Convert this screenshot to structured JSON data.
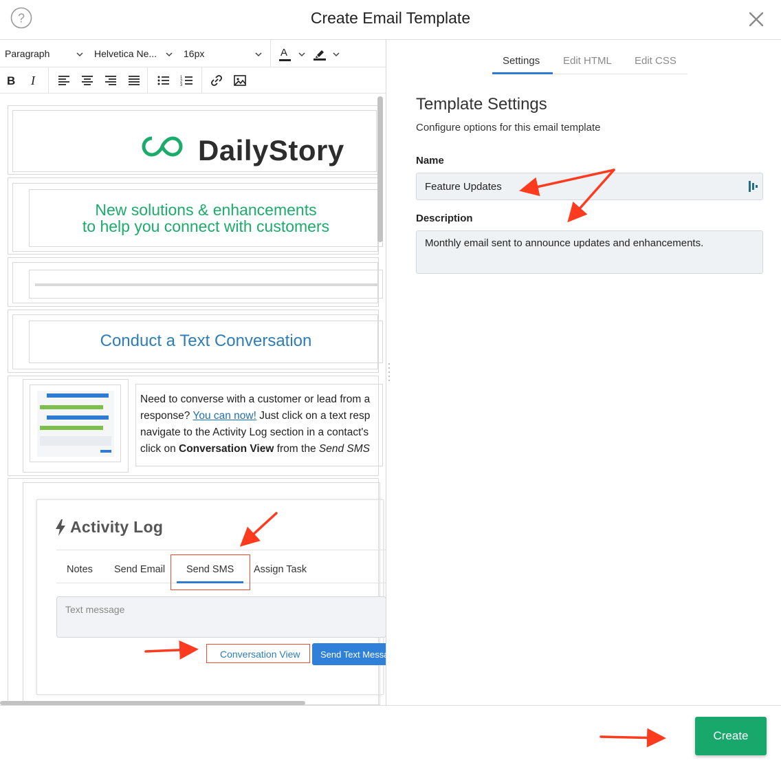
{
  "header": {
    "title": "Create Email Template"
  },
  "toolbar": {
    "block_format": "Paragraph",
    "font_family": "Helvetica Ne...",
    "font_size": "16px",
    "text_color_glyph": "A"
  },
  "email": {
    "logo_text": "DailyStory",
    "hero_line1": "New solutions & enhancements",
    "hero_line2": "to help you connect with customers",
    "heading": "Conduct a Text Conversation",
    "body_line1": "Need to converse with a customer or lead from a",
    "body_line2_pre": "response? ",
    "body_link": "You can now!",
    "body_line2_post": " Just click on a text resp",
    "body_line3": "navigate to the Activity Log section in a contact's",
    "body_line4_pre": "click on ",
    "body_line4_bold": "Conversation View",
    "body_line4_mid": " from the ",
    "body_line4_italic": "Send SMS",
    "activity": {
      "title": "Activity Log",
      "tabs": [
        "Notes",
        "Send Email",
        "Send SMS",
        "Assign Task"
      ],
      "input_placeholder": "Text message",
      "conversation_view": "Conversation View",
      "send_button": "Send Text Message"
    }
  },
  "panel": {
    "tabs": [
      "Settings",
      "Edit HTML",
      "Edit CSS"
    ],
    "active_tab": "Settings",
    "section_title": "Template Settings",
    "section_subtitle": "Configure options for this email template",
    "name_label": "Name",
    "name_value": "Feature Updates",
    "description_label": "Description",
    "description_value": "Monthly email sent to announce updates and enhancements."
  },
  "footer": {
    "create_label": "Create"
  },
  "colors": {
    "accent_green": "#18a86b",
    "link_blue": "#2d7db8",
    "tab_underline": "#2f7bd2",
    "annotation_red": "#ff3b1f"
  }
}
